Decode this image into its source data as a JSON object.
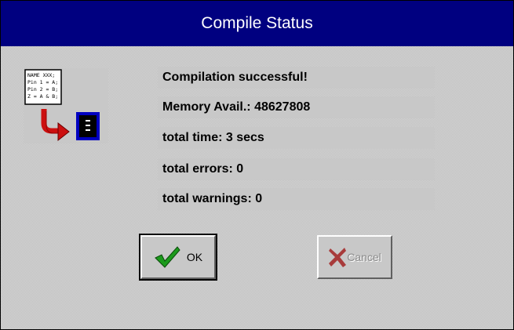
{
  "window": {
    "title": "Compile Status"
  },
  "illustration": {
    "code_lines": [
      "NAME XXX;",
      "Pin 1 = A;",
      "Pin 2 = B;",
      "Z = A & B;"
    ]
  },
  "status": {
    "lines": [
      "Compilation successful!",
      "Memory Avail.: 48627808",
      "total time: 3 secs",
      "total errors: 0",
      "total warnings: 0"
    ]
  },
  "buttons": {
    "ok_label": "OK",
    "cancel_label": "Cancel",
    "ok_icon": "checkmark-icon",
    "cancel_icon": "x-icon",
    "cancel_disabled": true
  },
  "colors": {
    "title_bar": "#000080",
    "title_text": "#ffffff",
    "checkmark": "#1c9a1c",
    "cancel_x": "#a01818",
    "arrow": "#cc1010",
    "chip_border": "#0000c0"
  }
}
